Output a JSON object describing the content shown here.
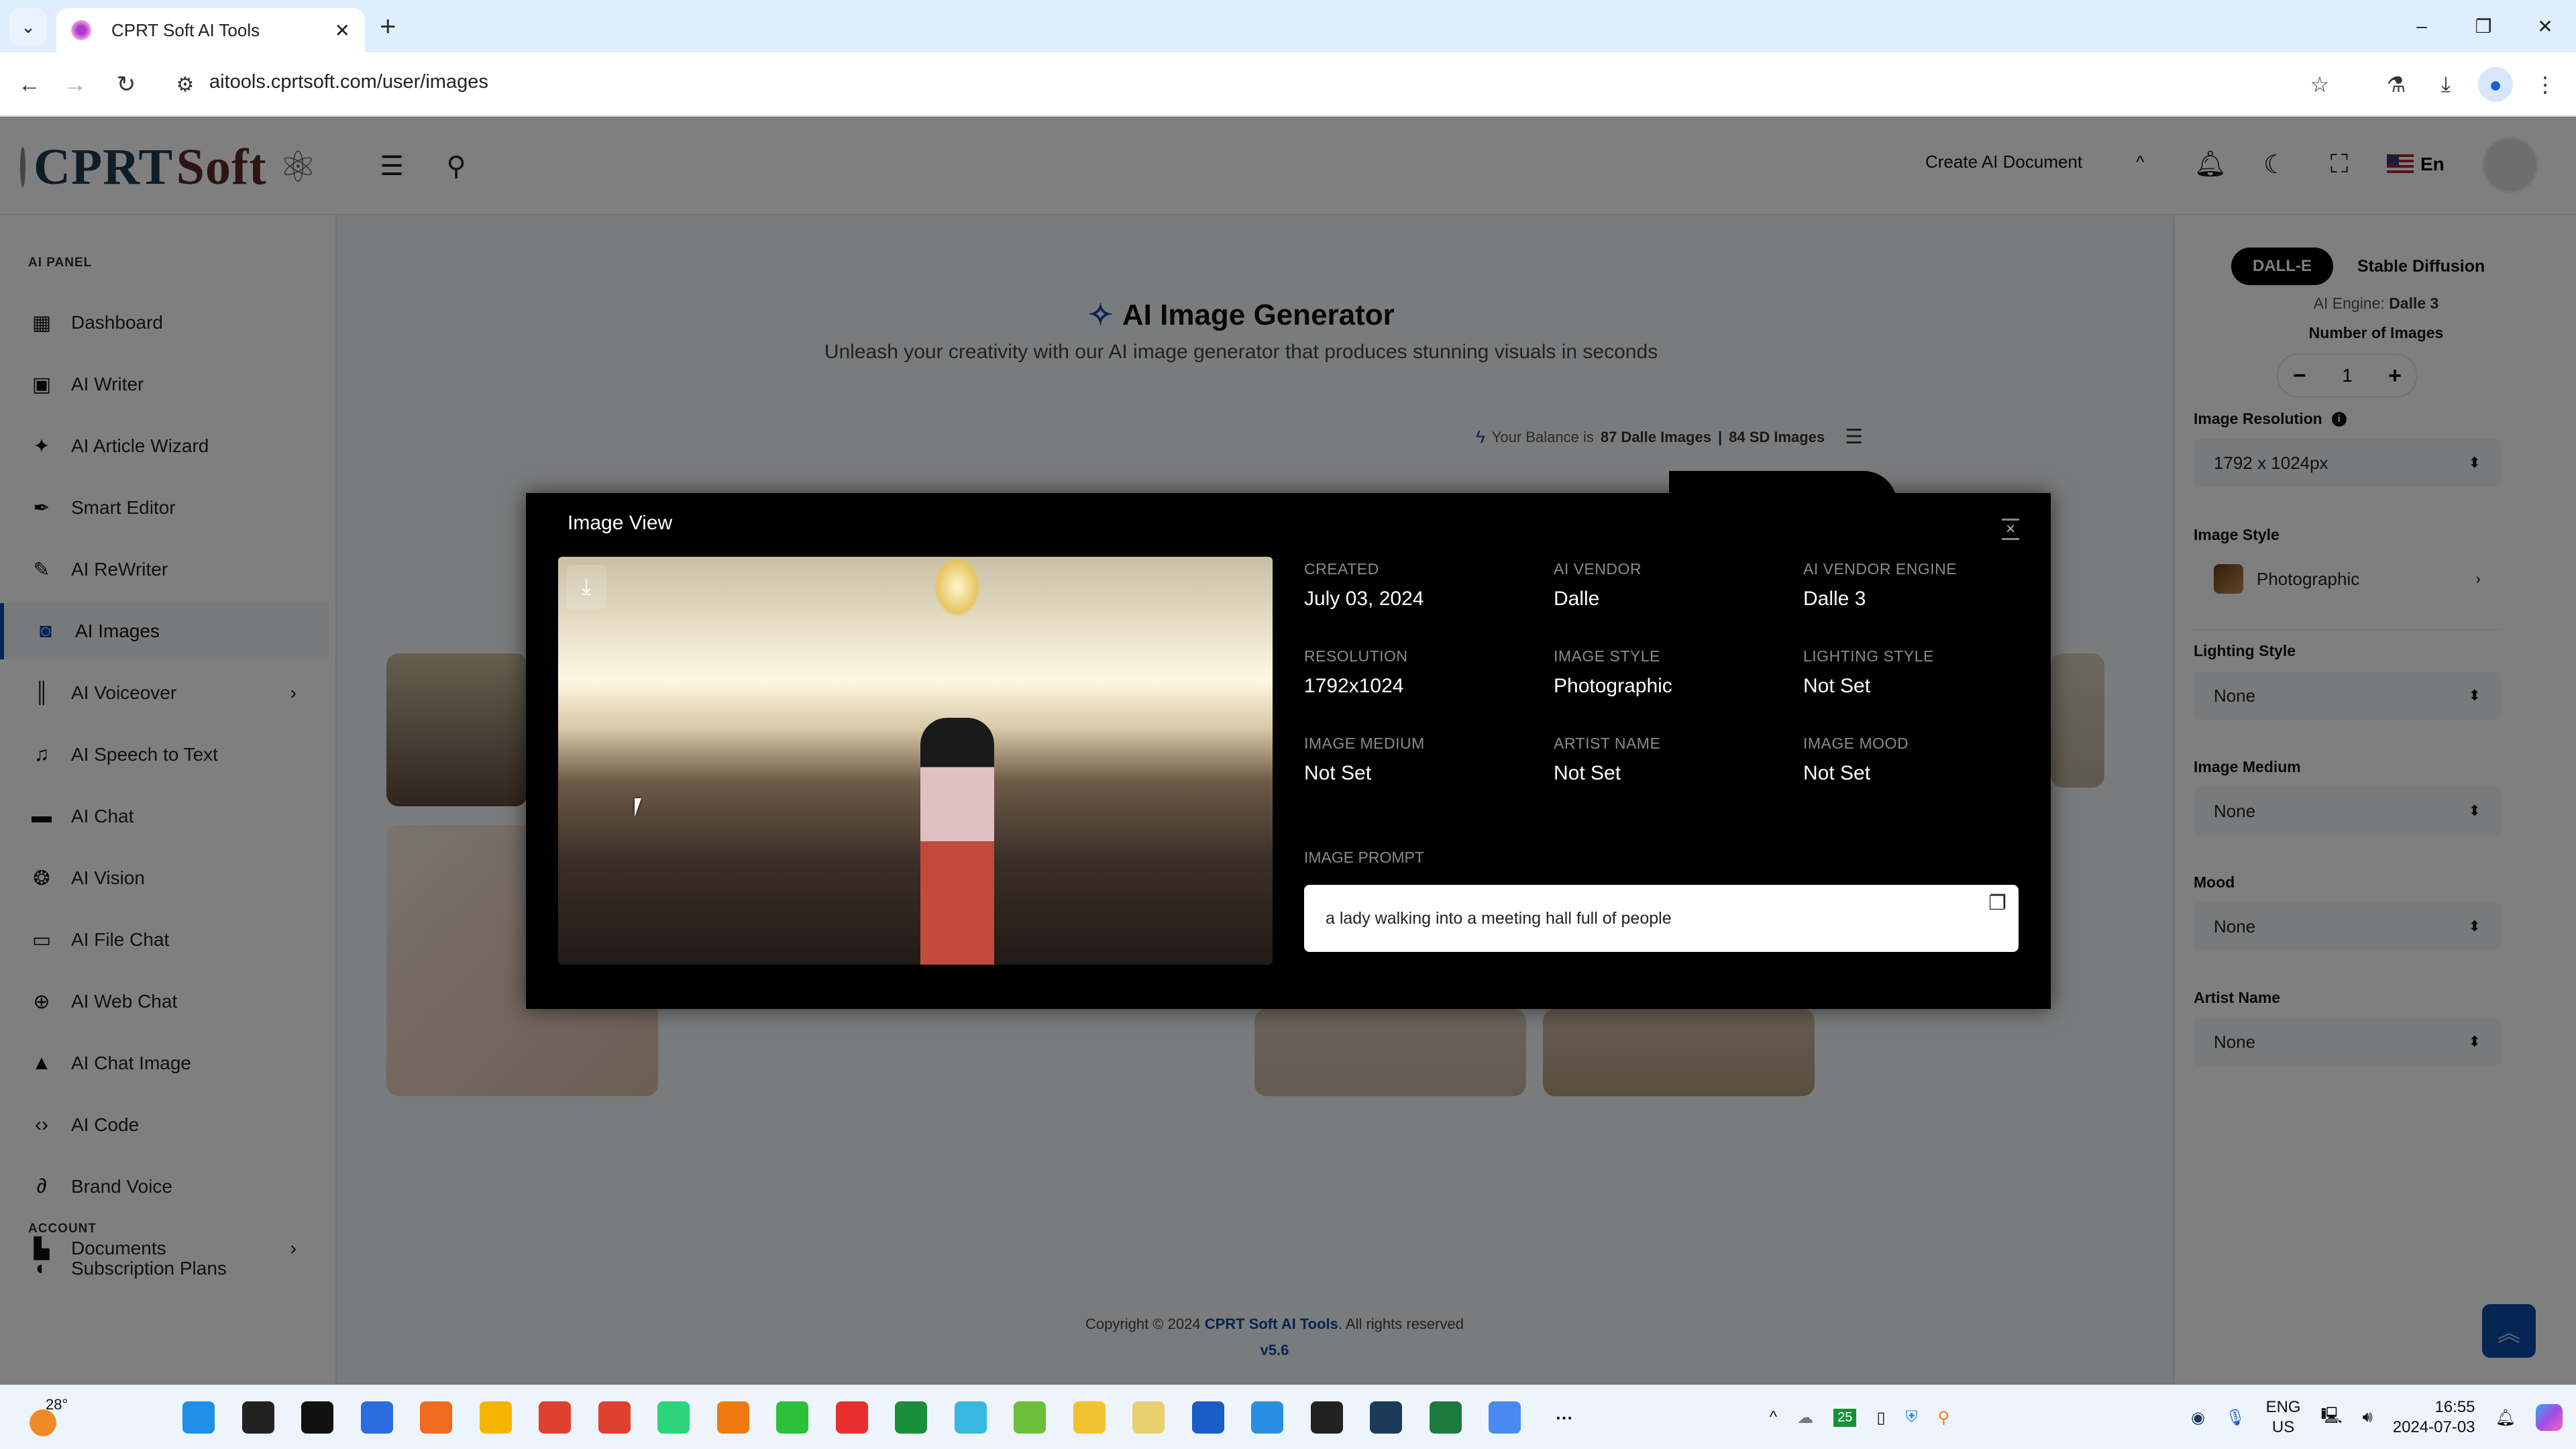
{
  "browser": {
    "tab_title": "CPRT Soft AI Tools",
    "url": "aitools.cprtsoft.com/user/images",
    "icons": [
      "back-arrow-icon",
      "forward-arrow-icon",
      "reload-icon",
      "site-settings-icon",
      "star-icon",
      "labs-flask-icon",
      "download-icon",
      "profile-icon",
      "more-vert-icon"
    ],
    "window_controls": {
      "minimize": "–",
      "restore": "❐",
      "close": "✕"
    }
  },
  "header": {
    "logo_part1": "CPRT",
    "logo_part2": "Soft",
    "create_doc_label": "Create AI Document",
    "create_doc_chevron": "^",
    "language": "En"
  },
  "sidebar": {
    "section_ai": "AI PANEL",
    "items": [
      {
        "label": "Dashboard",
        "icon": "▦"
      },
      {
        "label": "AI Writer",
        "icon": "▣"
      },
      {
        "label": "AI Article Wizard",
        "icon": "✦"
      },
      {
        "label": "Smart Editor",
        "icon": "✒"
      },
      {
        "label": "AI ReWriter",
        "icon": "✎"
      },
      {
        "label": "AI Images",
        "icon": "◙",
        "active": true
      },
      {
        "label": "AI Voiceover",
        "icon": "║",
        "has_submenu": true
      },
      {
        "label": "AI Speech to Text",
        "icon": "♫"
      },
      {
        "label": "AI Chat",
        "icon": "▬"
      },
      {
        "label": "AI Vision",
        "icon": "❂"
      },
      {
        "label": "AI File Chat",
        "icon": "▭"
      },
      {
        "label": "AI Web Chat",
        "icon": "⊕"
      },
      {
        "label": "AI Chat Image",
        "icon": "▲"
      },
      {
        "label": "AI Code",
        "icon": "‹›"
      },
      {
        "label": "Brand Voice",
        "icon": "∂"
      },
      {
        "label": "Documents",
        "icon": "▙",
        "has_submenu": true
      }
    ],
    "section_account": "ACCOUNT",
    "account_items": [
      {
        "label": "Subscription Plans",
        "icon": "◐"
      }
    ],
    "submenu_arrow": "›"
  },
  "main": {
    "title": "AI Image Generator",
    "subtitle": "Unleash your creativity with our AI image generator that produces stunning visuals in seconds",
    "balance_prefix": "Your Balance is",
    "balance_dalle": "87 Dalle Images",
    "balance_sep": "|",
    "balance_sd": "84 SD Images"
  },
  "right_panel": {
    "engine_tabs": [
      "DALL-E",
      "Stable Diffusion"
    ],
    "active_engine": "DALL-E",
    "engine_prefix": "AI Engine:",
    "engine_value": "Dalle 3",
    "num_images_label": "Number of Images",
    "num_images": "1",
    "minus": "−",
    "plus": "+",
    "fields": [
      {
        "label": "Image Resolution",
        "value": "1792 x 1024px",
        "info": true
      },
      {
        "label": "Image Style",
        "value": "Photographic"
      },
      {
        "label": "Lighting Style",
        "value": "None"
      },
      {
        "label": "Image Medium",
        "value": "None"
      },
      {
        "label": "Mood",
        "value": "None"
      },
      {
        "label": "Artist Name",
        "value": "None"
      }
    ]
  },
  "footer": {
    "copyright_prefix": "Copyright © 2024",
    "brand": "CPRT Soft AI Tools",
    "copyright_suffix": ". All rights reserved",
    "version": "v5.6"
  },
  "modal": {
    "title": "Image View",
    "close": "×",
    "meta": [
      {
        "key": "CREATED",
        "value": "July 03, 2024"
      },
      {
        "key": "AI VENDOR",
        "value": "Dalle"
      },
      {
        "key": "AI VENDOR ENGINE",
        "value": "Dalle 3"
      },
      {
        "key": "RESOLUTION",
        "value": "1792x1024"
      },
      {
        "key": "IMAGE STYLE",
        "value": "Photographic"
      },
      {
        "key": "LIGHTING STYLE",
        "value": "Not Set"
      },
      {
        "key": "IMAGE MEDIUM",
        "value": "Not Set"
      },
      {
        "key": "ARTIST NAME",
        "value": "Not Set"
      },
      {
        "key": "IMAGE MOOD",
        "value": "Not Set"
      }
    ],
    "prompt_label": "IMAGE PROMPT",
    "prompt": "a lady walking into a meeting hall full of people"
  },
  "taskbar": {
    "weather_temp": "28°",
    "apps": [
      "start",
      "task-view",
      "terminal",
      "powershell",
      "firefox",
      "chrome",
      "chrome-beta",
      "chrome-dev",
      "app-m",
      "search-tool",
      "app-green",
      "app-x",
      "app-a",
      "notepad",
      "notepad-plus",
      "file-explorer",
      "app-disk",
      "word",
      "calendar",
      "sticky",
      "steam",
      "excel",
      "chromium",
      "more"
    ],
    "tray_badge": "25",
    "lang_line1": "ENG",
    "lang_line2": "US",
    "time": "16:55",
    "date": "2024-07-03"
  },
  "colors": {
    "accent": "#0a4aa8",
    "modal_bg": "#000000",
    "overlay": "rgba(0,0,0,0.5)"
  }
}
